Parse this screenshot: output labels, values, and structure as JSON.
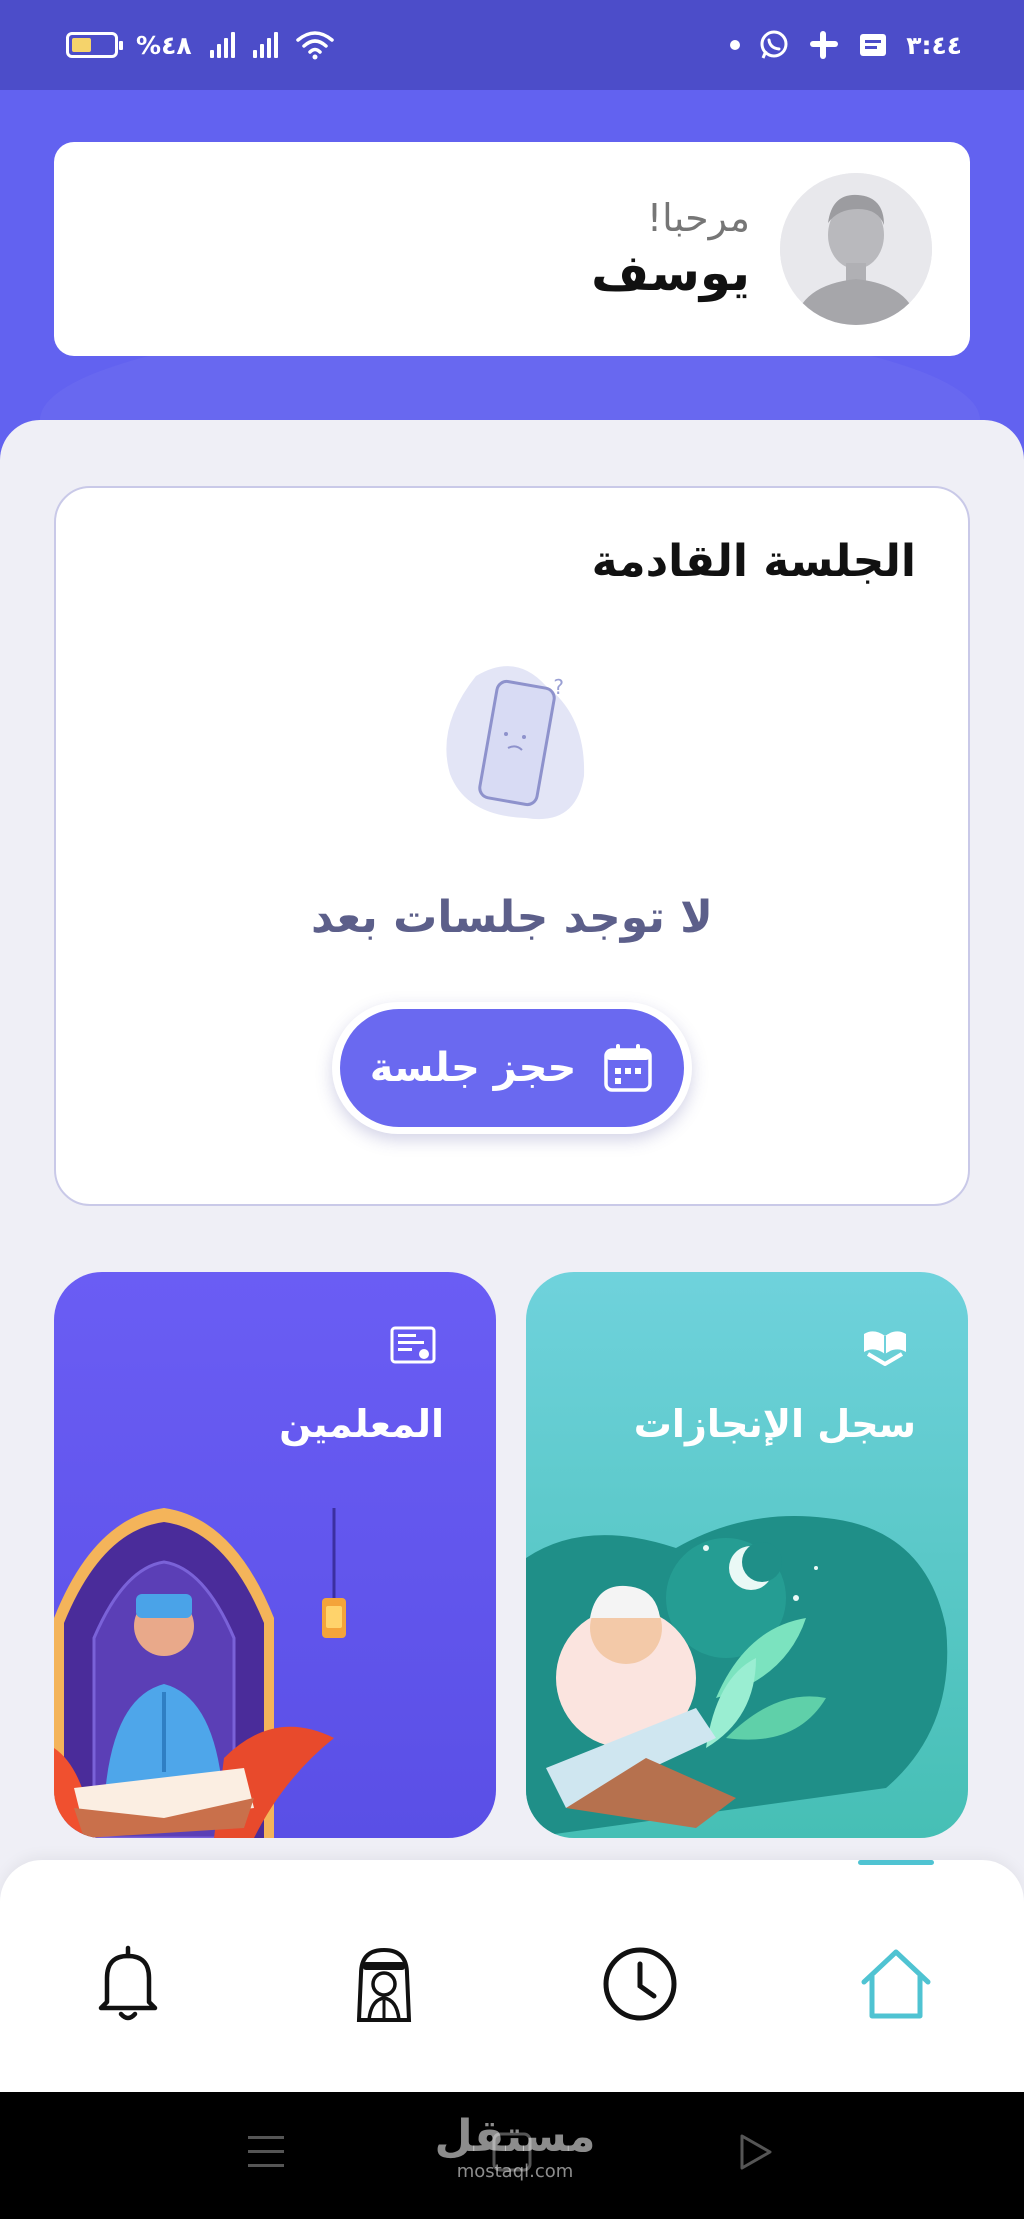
{
  "status_bar": {
    "time": "٣:٤٤",
    "battery_percent": "%٤٨",
    "battery_level": 0.48,
    "icons": [
      "notification-icon",
      "slack-icon",
      "whatsapp-icon",
      "dot-icon",
      "wifi-icon",
      "signal-icon",
      "signal-icon",
      "battery-icon"
    ]
  },
  "welcome": {
    "greeting": "مرحبا!",
    "username": "يوسف"
  },
  "upcoming_session": {
    "title": "الجلسة القادمة",
    "empty_message": "لا توجد جلسات بعد",
    "book_button_label": "حجز جلسة",
    "book_button_icon": "calendar-icon"
  },
  "tiles": {
    "achievements": {
      "title": "سجل الإنجازات",
      "icon": "quran-book-icon",
      "color": "#5ccbd0"
    },
    "teachers": {
      "title": "المعلمين",
      "icon": "certificate-icon",
      "color": "#6358f2"
    }
  },
  "bottom_nav": {
    "items": [
      {
        "name": "home",
        "icon": "home-icon",
        "active": true
      },
      {
        "name": "history",
        "icon": "clock-icon",
        "active": false
      },
      {
        "name": "teachers",
        "icon": "teacher-icon",
        "active": false
      },
      {
        "name": "notifications",
        "icon": "bell-icon",
        "active": false
      }
    ],
    "active_color": "#4fc3d2"
  },
  "watermark": {
    "main": "مستقل",
    "sub": "mostaql.com"
  },
  "colors": {
    "primary": "#6262f0",
    "status_bar": "#4c4dc9",
    "background": "#efeff6",
    "button": "#6a69f0"
  }
}
